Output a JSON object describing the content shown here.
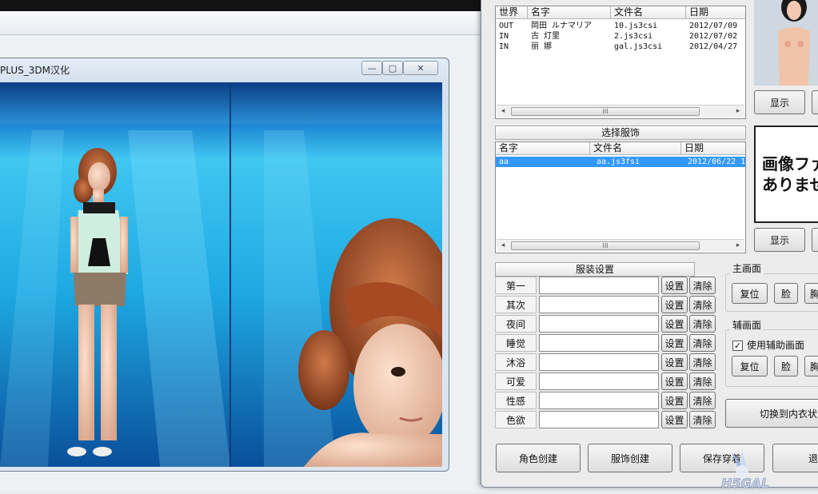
{
  "viewer": {
    "title": "PLUS_3DM汉化",
    "min_symbol": "▭",
    "max_symbol": "▢",
    "close_symbol": "✕"
  },
  "characters_list": {
    "header_partial": "世界",
    "columns": [
      "世界",
      "名字",
      "文件名",
      "日期"
    ],
    "rows": [
      [
        "OUT",
        "岡田 ルナマリア",
        "10.js3csi",
        "2012/07/09"
      ],
      [
        "IN",
        "古 灯里",
        "2.js3csi",
        "2012/07/02"
      ],
      [
        "IN",
        "丽 娜",
        "gal.js3csi",
        "2012/04/27"
      ]
    ]
  },
  "costume_list": {
    "title": "选择服饰",
    "columns": [
      "名字",
      "文件名",
      "日期"
    ],
    "rows": [
      [
        "aa",
        "aa.js3fsi",
        "2012/06/22 1"
      ]
    ]
  },
  "scroll": {
    "left": "◂",
    "right": "▸",
    "grip": "III"
  },
  "outfit_settings": {
    "title": "服装设置",
    "slots": [
      "第一",
      "其次",
      "夜间",
      "睡觉",
      "沐浴",
      "可爱",
      "性感",
      "色欲"
    ],
    "set_label": "设置",
    "clear_label": "清除"
  },
  "preview": {
    "show_label": "显示",
    "no_image_text": "画像ファ\nありませ"
  },
  "main_view": {
    "title": "主画面",
    "reset_label": "复位",
    "face_label": "脸",
    "chest_label": "胸"
  },
  "sub_view": {
    "title": "辅画面",
    "use_sub_label": "使用辅助画面",
    "use_sub_checked": true,
    "check_mark": "✓",
    "reset_label": "复位",
    "face_label": "脸",
    "chest_label": "胸"
  },
  "underwear_toggle_label": "切换到内衣状",
  "bottom_buttons": {
    "create_character": "角色创建",
    "create_costume": "服饰创建",
    "save_outfit": "保存穿着",
    "exit_partial": "退"
  },
  "watermark": "H5GAL"
}
